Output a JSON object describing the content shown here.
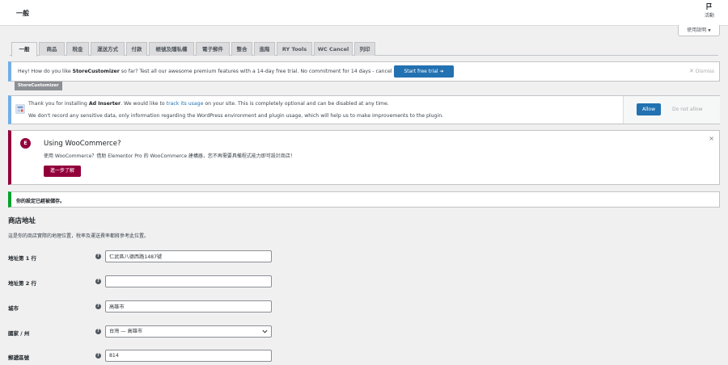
{
  "header": {
    "title": "一般",
    "activity_label": "活動"
  },
  "help_button": {
    "label": "使用說明",
    "arrow": "▼"
  },
  "tabs": [
    {
      "label": "一般",
      "active": true
    },
    {
      "label": "商品"
    },
    {
      "label": "稅金"
    },
    {
      "label": "運送方式"
    },
    {
      "label": "付款"
    },
    {
      "label": "帳號及隱私權"
    },
    {
      "label": "電子郵件"
    },
    {
      "label": "整合"
    },
    {
      "label": "進階"
    },
    {
      "label": "RY Tools"
    },
    {
      "label": "WC Cancel"
    },
    {
      "label": "列印"
    }
  ],
  "notice_storecustomizer": {
    "msg_pre": "Hey! How do you like ",
    "msg_bold": "StoreCustomizer",
    "msg_post": " so far? Test all our awesome premium features with a 14-day free trial. No commitment for 14 days - cancel anytime!",
    "button": "Start free trial ➔",
    "dismiss": "Dismiss",
    "tag": "StoreCustomizer"
  },
  "notice_ad_inserter": {
    "l1_pre": "Thank you for installing ",
    "l1_bold": "Ad Inserter",
    "l1_mid": ". We would like to ",
    "l1_link": "track its usage",
    "l1_post": " on your site. This is completely optional and can be disabled at any time.",
    "l2": "We don't record any sensitive data, only information regarding the WordPress environment and plugin usage, which will help us to make improvements to the plugin.",
    "allow": "Allow",
    "deny": "Do not allow"
  },
  "notice_elementor": {
    "logo": "E",
    "heading": "Using WooCommerce?",
    "text": "使用 WooCommerce？借助 Elementor Pro 的 WooCommerce 建構器，您不再需要具備程式能力即可設計商店！",
    "button": "進一步了解",
    "close": "×"
  },
  "notice_saved": {
    "msg": "你的設定已經被儲存。"
  },
  "section": {
    "title": "商店地址",
    "desc": "這是你的商店實際的地理位置，稅率及運送費率都將參考此位置。"
  },
  "fields": [
    {
      "label": "地址第 1 行",
      "value": "仁武區八德西路1487號"
    },
    {
      "label": "地址第 2 行",
      "value": ""
    },
    {
      "label": "城市",
      "value": "高雄市"
    },
    {
      "label": "國家 / 州",
      "value": "台灣 — 高雄市",
      "type": "select"
    },
    {
      "label": "郵遞區號",
      "value": "814"
    }
  ],
  "help_tip_glyph": "?",
  "colors": {
    "accent": "#2271b1",
    "elementor": "#92003b",
    "success": "#00a32a",
    "info": "#72aee6"
  }
}
